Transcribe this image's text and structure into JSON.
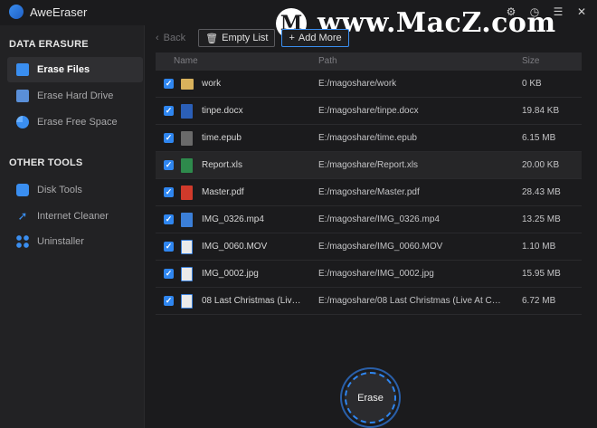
{
  "app": {
    "title": "AweEraser"
  },
  "window_controls": {
    "settings": "⚙",
    "history": "◷",
    "menu": "☰",
    "close": "✕"
  },
  "watermark": {
    "logo_letter": "M",
    "text": "www.MacZ.com"
  },
  "sidebar": {
    "data_erasure_title": "DATA ERASURE",
    "other_tools_title": "OTHER TOOLS",
    "items": [
      {
        "label": "Erase Files",
        "icon": "folder-icon"
      },
      {
        "label": "Erase Hard Drive",
        "icon": "drive-icon"
      },
      {
        "label": "Erase Free Space",
        "icon": "pie-icon"
      },
      {
        "label": "Disk Tools",
        "icon": "bag-icon"
      },
      {
        "label": "Internet Cleaner",
        "icon": "rocket-icon"
      },
      {
        "label": "Uninstaller",
        "icon": "apps-icon"
      }
    ]
  },
  "toolbar": {
    "back_label": "Back",
    "empty_list_label": "Empty List",
    "add_more_label": "Add More"
  },
  "table": {
    "headers": {
      "name": "Name",
      "path": "Path",
      "size": "Size"
    },
    "rows": [
      {
        "name": "work",
        "path": "E:/magoshare/work",
        "size": "0 KB",
        "type": "folder"
      },
      {
        "name": "tinpe.docx",
        "path": "E:/magoshare/tinpe.docx",
        "size": "19.84 KB",
        "type": "docx"
      },
      {
        "name": "time.epub",
        "path": "E:/magoshare/time.epub",
        "size": "6.15 MB",
        "type": "epub"
      },
      {
        "name": "Report.xls",
        "path": "E:/magoshare/Report.xls",
        "size": "20.00 KB",
        "type": "xls"
      },
      {
        "name": "Master.pdf",
        "path": "E:/magoshare/Master.pdf",
        "size": "28.43 MB",
        "type": "pdf"
      },
      {
        "name": "IMG_0326.mp4",
        "path": "E:/magoshare/IMG_0326.mp4",
        "size": "13.25 MB",
        "type": "mp4"
      },
      {
        "name": "IMG_0060.MOV",
        "path": "E:/magoshare/IMG_0060.MOV",
        "size": "1.10 MB",
        "type": "mov"
      },
      {
        "name": "IMG_0002.jpg",
        "path": "E:/magoshare/IMG_0002.jpg",
        "size": "15.95 MB",
        "type": "jpg"
      },
      {
        "name": "08 Last Christmas  (Live A...",
        "path": "E:/magoshare/08 Last Christmas  (Live At Christ...",
        "size": "6.72 MB",
        "type": "audio"
      }
    ]
  },
  "erase_button": {
    "label": "Erase"
  },
  "colors": {
    "accent": "#2f86f0",
    "background": "#1b1b1d",
    "sidebar": "#222224"
  }
}
